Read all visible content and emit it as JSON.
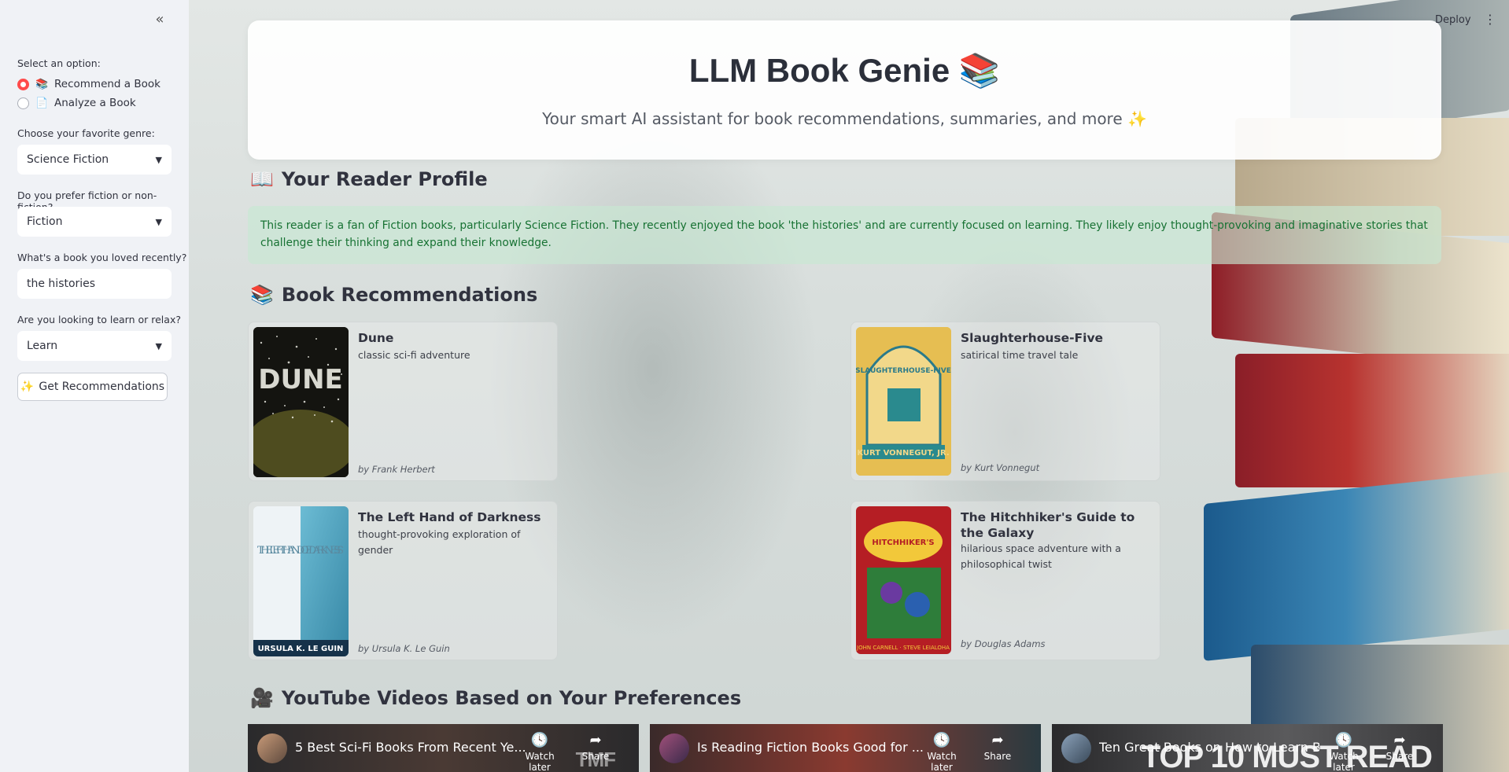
{
  "header": {
    "deploy_label": "Deploy",
    "more_icon": "⋮"
  },
  "sidebar": {
    "collapse_icon": "«",
    "option_label": "Select an option:",
    "options": [
      {
        "emoji": "📚",
        "label": "Recommend a Book",
        "selected": true
      },
      {
        "emoji": "📄",
        "label": "Analyze a Book",
        "selected": false
      }
    ],
    "genre": {
      "label": "Choose your favorite genre:",
      "value": "Science Fiction"
    },
    "fiction": {
      "label": "Do you prefer fiction or non-fiction?",
      "value": "Fiction"
    },
    "loved": {
      "label": "What's a book you loved recently?",
      "value": "the histories"
    },
    "purpose": {
      "label": "Are you looking to learn or relax?",
      "value": "Learn"
    },
    "button": {
      "emoji": "✨",
      "label": "Get Recommendations"
    }
  },
  "hero": {
    "title": "LLM Book Genie 📚",
    "subtitle": "Your smart AI assistant for book recommendations, summaries, and more ✨"
  },
  "profile": {
    "emoji": "📖",
    "heading": "Your Reader Profile",
    "text": "This reader is a fan of Fiction books, particularly Science Fiction. They recently enjoyed the book 'the histories' and are currently focused on learning. They likely enjoy thought-provoking and imaginative stories that challenge their thinking and expand their knowledge."
  },
  "recommendations": {
    "emoji": "📚",
    "heading": "Book Recommendations",
    "books": [
      {
        "title": "Dune",
        "desc": "classic sci-fi adventure",
        "author": "by Frank Herbert",
        "cover_text": "DUNE"
      },
      {
        "title": "Slaughterhouse-Five",
        "desc": "satirical time travel tale",
        "author": "by Kurt Vonnegut",
        "cover_text": "SLAUGHTERHOUSE-FIVE"
      },
      {
        "title": "The Left Hand of Darkness",
        "desc": "thought-provoking exploration of gender",
        "author": "by Ursula K. Le Guin",
        "cover_text": "THE LEFT HAND OF DARKNESS"
      },
      {
        "title": "The Hitchhiker's Guide to the Galaxy",
        "desc": "hilarious space adventure with a philosophical twist",
        "author": "by Douglas Adams",
        "cover_text": "HITCHHIKER'S"
      }
    ]
  },
  "videos": {
    "emoji": "🎥",
    "heading": "YouTube Videos Based on Your Preferences",
    "watch_later": "Watch later",
    "share": "Share",
    "items": [
      {
        "title": "5 Best Sci-Fi Books From Recent Ye...",
        "overlay": "TMF"
      },
      {
        "title": "Is Reading Fiction Books Good for ...",
        "overlay": ""
      },
      {
        "title": "Ten Great Books on How to Learn B...",
        "overlay": "TOP 10 MUST READ"
      }
    ]
  }
}
